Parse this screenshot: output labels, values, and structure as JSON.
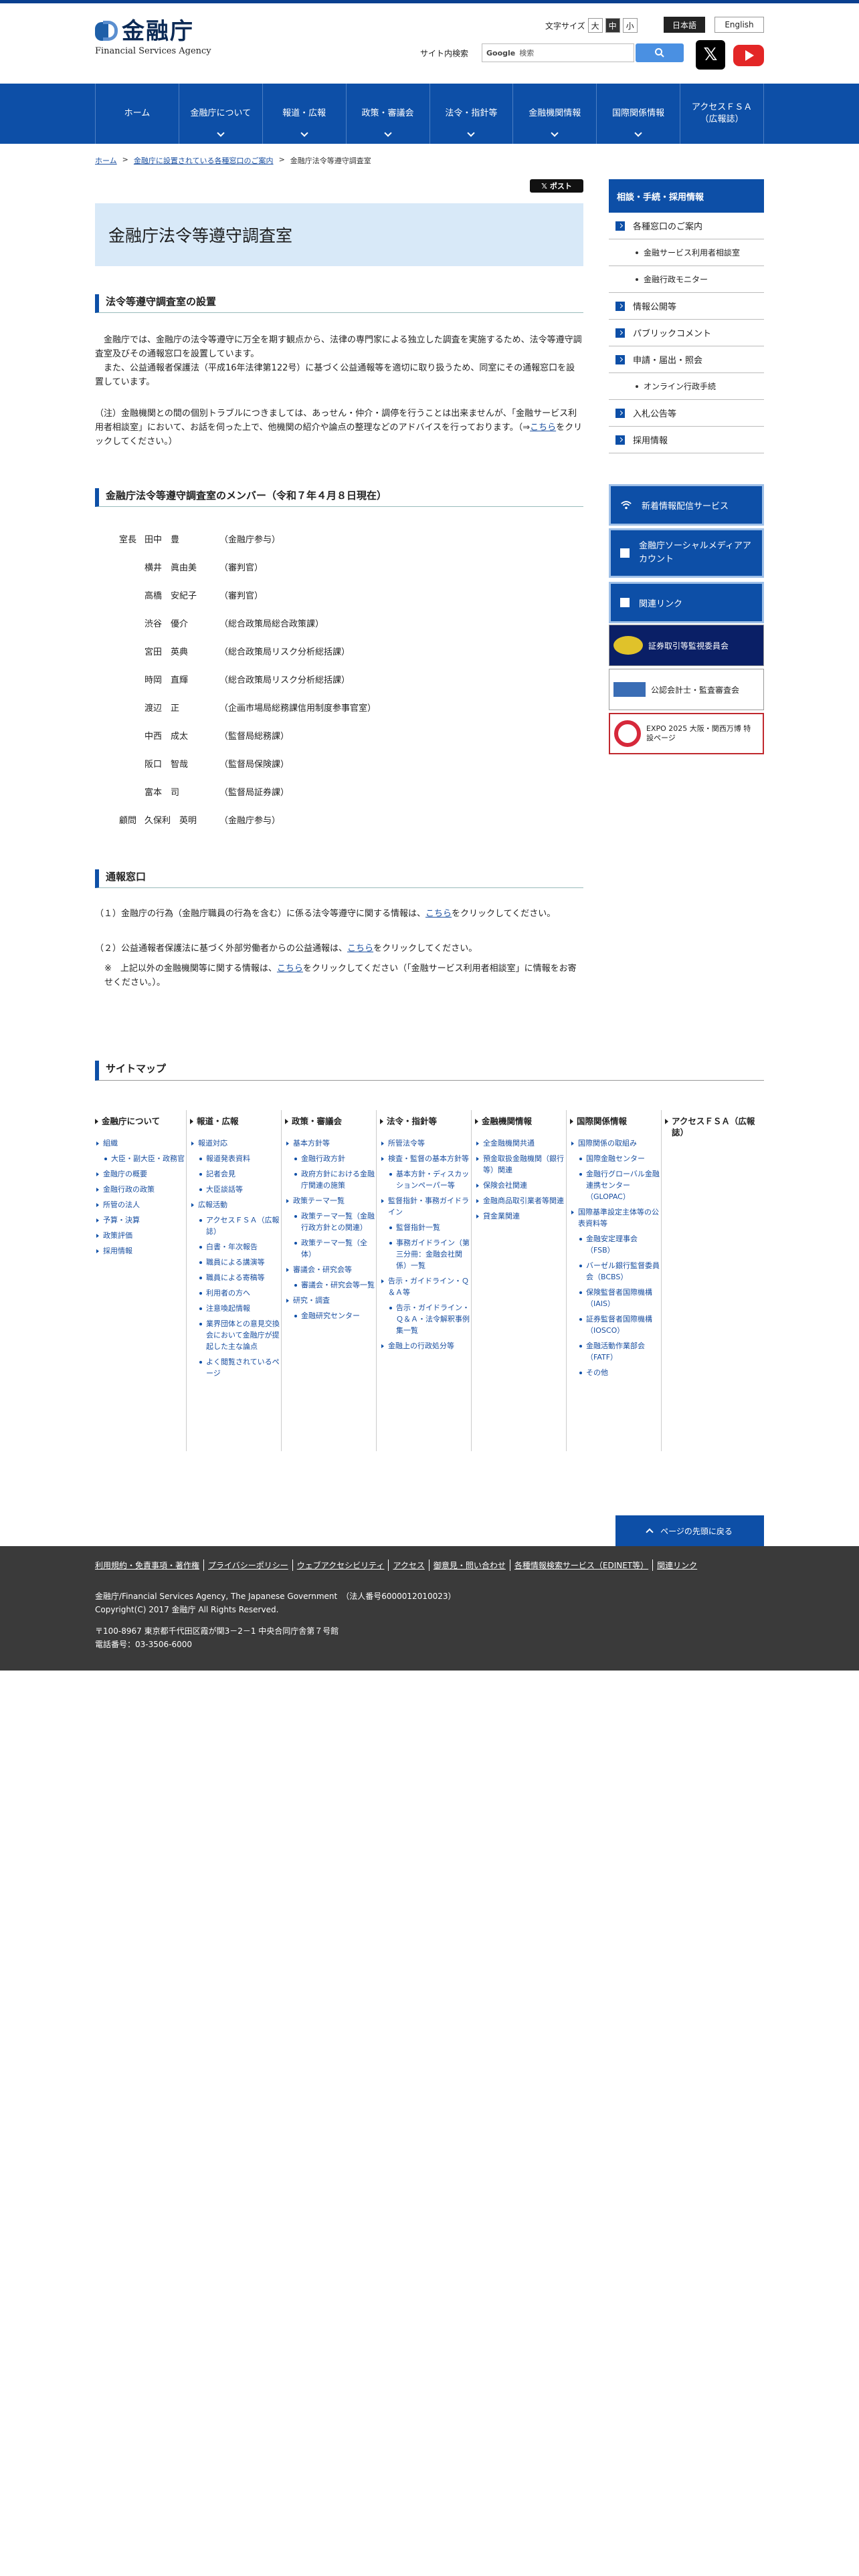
{
  "header": {
    "logo_text": "金融庁",
    "logo_sub": "Financial Services Agency",
    "fontsize_label": "文字サイズ",
    "fontsize_options": [
      "大",
      "中",
      "小"
    ],
    "lang_ja": "日本語",
    "lang_en": "English",
    "search_label": "サイト内検索",
    "search_brand": "Google",
    "search_placeholder": "検索"
  },
  "gnav": [
    "ホーム",
    "金融庁について",
    "報道・広報",
    "政策・審議会",
    "法令・指針等",
    "金融機関情報",
    "国際関係情報",
    "アクセスＦＳＡ\n（広報誌）"
  ],
  "breadcrumb": [
    "ホーム",
    "金融庁に設置されている各種窓口のご案内",
    "金融庁法令等遵守調査室"
  ],
  "post_button": "𝕏 ポスト",
  "page_title": "金融庁法令等遵守調査室",
  "section1": {
    "heading": "法令等遵守調査室の設置",
    "p1": "　金融庁では、金融庁の法令等遵守に万全を期す観点から、法律の専門家による独立した調査を実施するため、法令等遵守調査室及びその通報窓口を設置しています。",
    "p2": "　また、公益通報者保護法（平成16年法律第122号）に基づく公益通報等を適切に取り扱うため、同室にその通報窓口を設置しています。",
    "note_prefix": "（注）金融機関との間の個別トラブルにつきましては、あっせん・仲介・調停を行うことは出来ませんが、「金融サービス利用者相談室」において、お話を伺った上で、他機関の紹介や論点の整理などのアドバイスを行っております。（⇒",
    "note_link": "こちら",
    "note_suffix": "をクリックしてください。）"
  },
  "section2": {
    "heading": "金融庁法令等遵守調査室のメンバー（令和７年４月８日現在）",
    "members": [
      {
        "role": "室長",
        "name": "田中　豊",
        "title": "（金融庁参与）"
      },
      {
        "role": "",
        "name": "横井　眞由美",
        "title": "（審判官）"
      },
      {
        "role": "",
        "name": "高橋　安紀子",
        "title": "（審判官）"
      },
      {
        "role": "",
        "name": "渋谷　優介",
        "title": "（総合政策局総合政策課）"
      },
      {
        "role": "",
        "name": "宮田　英典",
        "title": "（総合政策局リスク分析総括課）"
      },
      {
        "role": "",
        "name": "時岡　直輝",
        "title": "（総合政策局リスク分析総括課）"
      },
      {
        "role": "",
        "name": "渡辺　正",
        "title": "（企画市場局総務課信用制度参事官室）"
      },
      {
        "role": "",
        "name": "中西　成太",
        "title": "（監督局総務課）"
      },
      {
        "role": "",
        "name": "阪口　智哉",
        "title": "（監督局保険課）"
      },
      {
        "role": "",
        "name": "富本　司",
        "title": "（監督局証券課）"
      },
      {
        "role": "顧問",
        "name": "久保利　英明",
        "title": "（金融庁参与）"
      }
    ]
  },
  "section3": {
    "heading": "通報窓口",
    "item1_prefix": "（１）金融庁の行為（金融庁職員の行為を含む）に係る法令等遵守に関する情報は、",
    "item1_link": "こちら",
    "item1_suffix": "をクリックしてください。",
    "item2_prefix": "（２）公益通報者保護法に基づく外部労働者からの公益通報は、",
    "item2_link": "こちら",
    "item2_suffix": "をクリックしてください。",
    "item3_prefix": "※　上記以外の金融機関等に関する情報は、",
    "item3_link": "こちら",
    "item3_suffix": "をクリックしてください（「金融サービス利用者相談室」に情報をお寄せください。）。"
  },
  "sidenav": {
    "heading": "相談・手続・採用情報",
    "items": [
      {
        "label": "各種窓口のご案内",
        "level": 1
      },
      {
        "label": "金融サービス利用者相談室",
        "level": 2
      },
      {
        "label": "金融行政モニター",
        "level": 2
      },
      {
        "label": "情報公開等",
        "level": 1
      },
      {
        "label": "パブリックコメント",
        "level": 1
      },
      {
        "label": "申請・届出・照会",
        "level": 1
      },
      {
        "label": "オンライン行政手続",
        "level": 2
      },
      {
        "label": "入札公告等",
        "level": 1
      },
      {
        "label": "採用情報",
        "level": 1
      }
    ],
    "banners": [
      "新着情報配信サービス",
      "金融庁ソーシャルメディアアカウント",
      "関連リンク",
      "証券取引等監視委員会",
      "公認会計士・監査審査会",
      "EXPO 2025 大阪・関西万博 特設ページ"
    ]
  },
  "sitemap": {
    "title": "サイトマップ",
    "columns": [
      {
        "head": "金融庁について",
        "items": [
          {
            "t": "組織",
            "l": 1
          },
          {
            "t": "大臣・副大臣・政務官",
            "l": 2
          },
          {
            "t": "金融庁の概要",
            "l": 1
          },
          {
            "t": "金融行政の政策",
            "l": 1
          },
          {
            "t": "所管の法人",
            "l": 1
          },
          {
            "t": "予算・決算",
            "l": 1
          },
          {
            "t": "政策評価",
            "l": 1
          },
          {
            "t": "採用情報",
            "l": 1
          }
        ]
      },
      {
        "head": "報道・広報",
        "items": [
          {
            "t": "報道対応",
            "l": 1
          },
          {
            "t": "報道発表資料",
            "l": 2
          },
          {
            "t": "記者会見",
            "l": 2
          },
          {
            "t": "大臣談話等",
            "l": 2
          },
          {
            "t": "広報活動",
            "l": 1
          },
          {
            "t": "アクセスＦＳＡ（広報誌）",
            "l": 2
          },
          {
            "t": "白書・年次報告",
            "l": 2
          },
          {
            "t": "職員による講演等",
            "l": 2
          },
          {
            "t": "職員による寄稿等",
            "l": 2
          },
          {
            "t": "利用者の方へ",
            "l": 2
          },
          {
            "t": "注意喚起情報",
            "l": 2
          },
          {
            "t": "業界団体との意見交換会において金融庁が提起した主な論点",
            "l": 2
          },
          {
            "t": "よく閲覧されているページ",
            "l": 2
          }
        ]
      },
      {
        "head": "政策・審議会",
        "items": [
          {
            "t": "基本方針等",
            "l": 1
          },
          {
            "t": "金融行政方針",
            "l": 2
          },
          {
            "t": "政府方針における金融庁関連の施策",
            "l": 2
          },
          {
            "t": "政策テーマ一覧",
            "l": 1
          },
          {
            "t": "政策テーマ一覧（金融行政方針との関連）",
            "l": 2
          },
          {
            "t": "政策テーマ一覧（全体）",
            "l": 2
          },
          {
            "t": "審議会・研究会等",
            "l": 1
          },
          {
            "t": "審議会・研究会等一覧",
            "l": 2
          },
          {
            "t": "研究・調査",
            "l": 1
          },
          {
            "t": "金融研究センター",
            "l": 2
          }
        ]
      },
      {
        "head": "法令・指針等",
        "items": [
          {
            "t": "所管法令等",
            "l": 1
          },
          {
            "t": "検査・監督の基本方針等",
            "l": 1
          },
          {
            "t": "基本方針・ディスカッションペーパー等",
            "l": 2
          },
          {
            "t": "監督指針・事務ガイドライン",
            "l": 1
          },
          {
            "t": "監督指針一覧",
            "l": 2
          },
          {
            "t": "事務ガイドライン（第三分冊：金融会社関係）一覧",
            "l": 2
          },
          {
            "t": "告示・ガイドライン・Ｑ＆Ａ等",
            "l": 1
          },
          {
            "t": "告示・ガイドライン・Ｑ＆Ａ・法令解釈事例集一覧",
            "l": 2
          },
          {
            "t": "金融上の行政処分等",
            "l": 1
          }
        ]
      },
      {
        "head": "金融機関情報",
        "items": [
          {
            "t": "全金融機関共通",
            "l": 1
          },
          {
            "t": "預金取扱金融機関（銀行等）関連",
            "l": 1
          },
          {
            "t": "保険会社関連",
            "l": 1
          },
          {
            "t": "金融商品取引業者等関連",
            "l": 1
          },
          {
            "t": "貸金業関連",
            "l": 1
          }
        ]
      },
      {
        "head": "国際関係情報",
        "items": [
          {
            "t": "国際関係の取組み",
            "l": 1
          },
          {
            "t": "国際金融センター",
            "l": 2
          },
          {
            "t": "金融行グローバル金融連携センター（GLOPAC）",
            "l": 2
          },
          {
            "t": "国際基準設定主体等の公表資料等",
            "l": 1
          },
          {
            "t": "金融安定理事会（FSB）",
            "l": 2
          },
          {
            "t": "バーゼル銀行監督委員会（BCBS）",
            "l": 2
          },
          {
            "t": "保険監督者国際機構（IAIS）",
            "l": 2
          },
          {
            "t": "証券監督者国際機構（IOSCO）",
            "l": 2
          },
          {
            "t": "金融活動作業部会（FATF）",
            "l": 2
          },
          {
            "t": "その他",
            "l": 2
          }
        ]
      },
      {
        "head": "アクセスＦＳＡ（広報誌）",
        "items": []
      }
    ]
  },
  "pagetop": "ページの先頭に戻る",
  "footer": {
    "links": [
      "利用規約・免責事項・著作権",
      "プライバシーポリシー",
      "ウェブアクセシビリティ",
      "アクセス",
      "御意見・問い合わせ",
      "各種情報検索サービス（EDINET等）",
      "関連リンク"
    ],
    "line1": "金融庁/Financial Services Agency, The Japanese Government　（法人番号6000012010023）",
    "line2": "Copyright(C) 2017 金融庁 All Rights Reserved.",
    "line3": "〒100-8967 東京都千代田区霞が関3－2－1 中央合同庁舎第７号館",
    "line4": "電話番号：03-3506-6000"
  }
}
